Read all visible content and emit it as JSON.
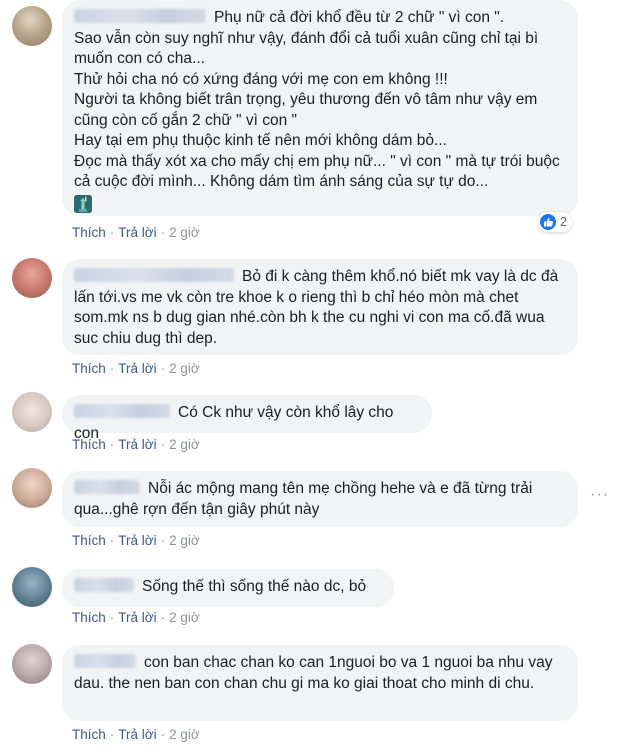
{
  "comments": [
    {
      "text": "Phụ nữ cả đời khổ đều từ 2 chữ \" vì con \".\nSao vẫn còn suy nghĩ như vậy, đánh đổi cả tuổi xuân cũng chỉ tại bì muốn con có cha...\nThử hỏi cha nó có xứng đáng với mẹ con em không !!!\nNgười ta không biết trân trọng, yêu thương đến vô tâm như vậy em cũng còn cố gắn 2 chữ \" vì con \"\nHay tại em phụ thuộc kinh tế nên mới không dám bỏ...\nĐọc mà thấy xót xa cho mấy chị em phụ nữ... \" vì con \" mà tự trói buộc cả cuộc đời mình... Không dám tìm ánh sáng của sự tự do...",
      "reaction_count": "2",
      "like": "Thích",
      "reply": "Trả lời",
      "time": "2 giờ"
    },
    {
      "text": "Bỏ đi k càng thêm khổ.nó biết mk vay là dc đà lấn tới.vs me vk còn tre khoe k o rieng thì b chỉ héo mòn mà chet som.mk ns b dug gian nhé.còn bh k the cu nghi vi con ma cố.đã wua suc chiu dug thì dep.",
      "like": "Thích",
      "reply": "Trả lời",
      "time": "2 giờ"
    },
    {
      "text": "Có Ck như vậy còn khổ lây cho con",
      "like": "Thích",
      "reply": "Trả lời",
      "time": "2 giờ"
    },
    {
      "text": "Nỗi ác mộng mang tên mẹ chồng hehe và e đã từng trải qua...ghê rợn đến tận giây phút này",
      "like": "Thích",
      "reply": "Trả lời",
      "time": "2 giờ"
    },
    {
      "text": "Sống thế thì sống thế nào dc, bỏ",
      "like": "Thích",
      "reply": "Trả lời",
      "time": "2 giờ"
    },
    {
      "text": "con ban chac chan ko can 1nguoi bo va 1 nguoi ba nhu vay dau. the nen ban con chan chu gi ma ko giai thoat cho minh di chu.",
      "like": "Thích",
      "reply": "Trả lời",
      "time": "2 giờ"
    }
  ],
  "icons": {
    "like_reaction": "like-icon",
    "more": "more-options-icon",
    "emoji": "statue-of-liberty-emoji"
  },
  "colors": {
    "bubble": "#f2f3f5",
    "link": "#385898",
    "meta": "#90949c",
    "like_blue": "#1877f2"
  }
}
